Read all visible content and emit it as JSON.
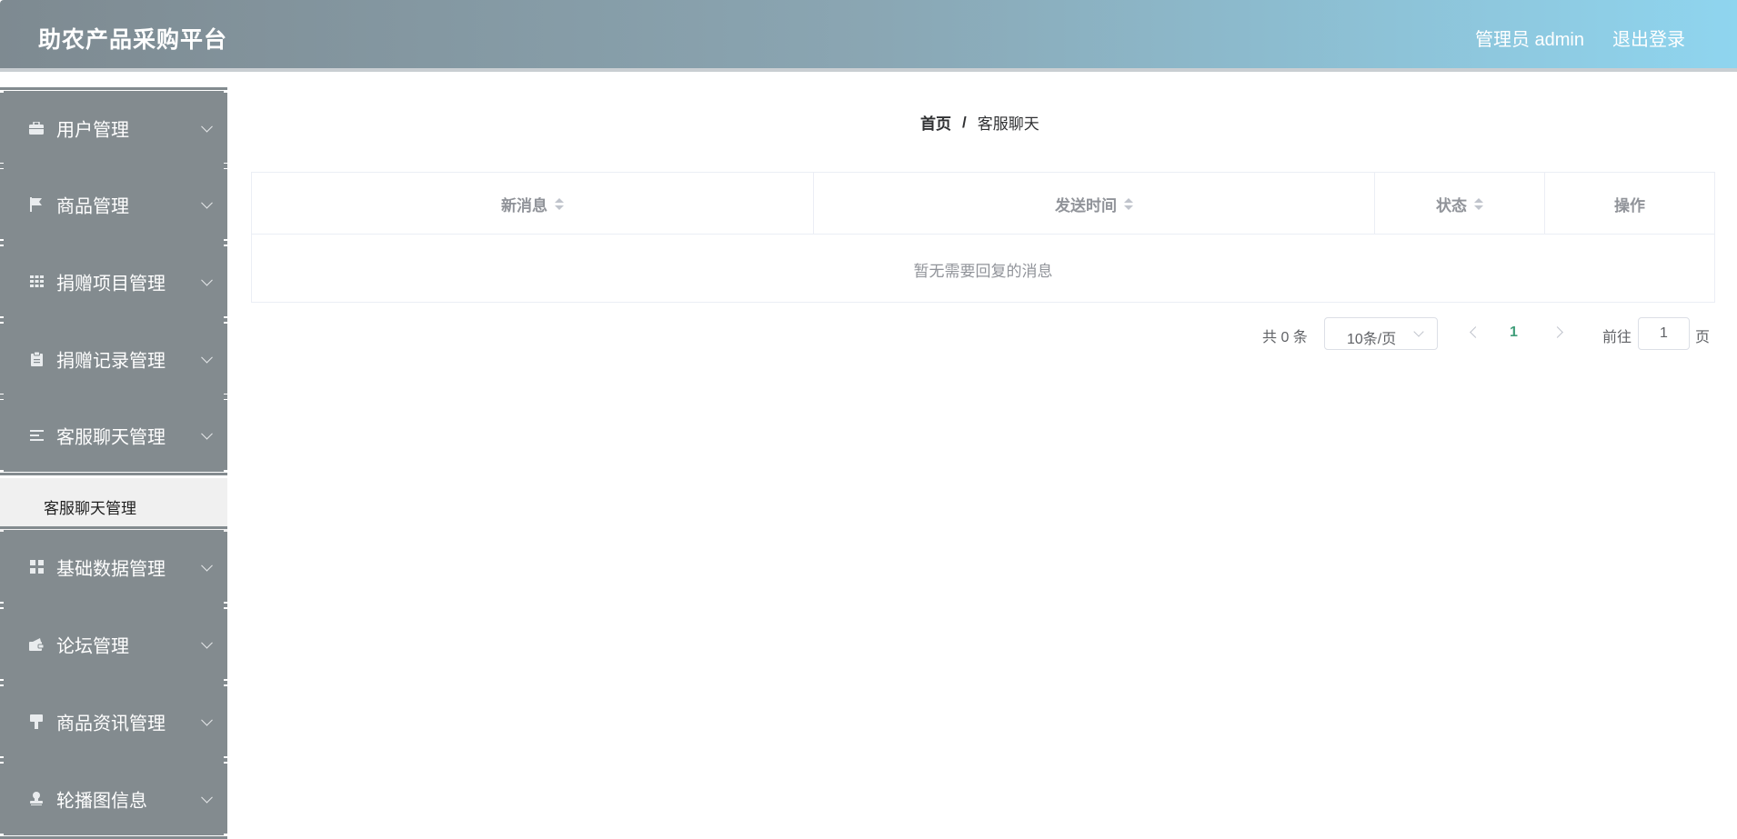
{
  "header": {
    "title": "助农产品采购平台",
    "user_label": "管理员 admin",
    "logout_label": "退出登录"
  },
  "sidebar": {
    "items": [
      {
        "label": "用户管理",
        "icon": "briefcase-icon"
      },
      {
        "label": "商品管理",
        "icon": "flag-icon"
      },
      {
        "label": "捐赠项目管理",
        "icon": "grid-icon"
      },
      {
        "label": "捐赠记录管理",
        "icon": "clipboard-icon"
      },
      {
        "label": "客服聊天管理",
        "icon": "list-icon"
      },
      {
        "label": "基础数据管理",
        "icon": "tiles-icon"
      },
      {
        "label": "论坛管理",
        "icon": "wallet-icon"
      },
      {
        "label": "商品资讯管理",
        "icon": "brush-icon"
      },
      {
        "label": "轮播图信息",
        "icon": "stamp-icon"
      }
    ],
    "submenu": {
      "label": "客服聊天管理"
    }
  },
  "breadcrumb": {
    "home": "首页",
    "separator": "/",
    "current": "客服聊天"
  },
  "table": {
    "columns": [
      "新消息",
      "发送时间",
      "状态",
      "操作"
    ],
    "empty_text": "暂无需要回复的消息"
  },
  "pagination": {
    "total": "共 0 条",
    "page_size": "10条/页",
    "current_page": "1",
    "goto_prefix": "前往",
    "goto_value": "1",
    "goto_suffix": "页"
  },
  "colors": {
    "sidebar_bg": "#838b8f",
    "active_page": "#409e7a"
  }
}
